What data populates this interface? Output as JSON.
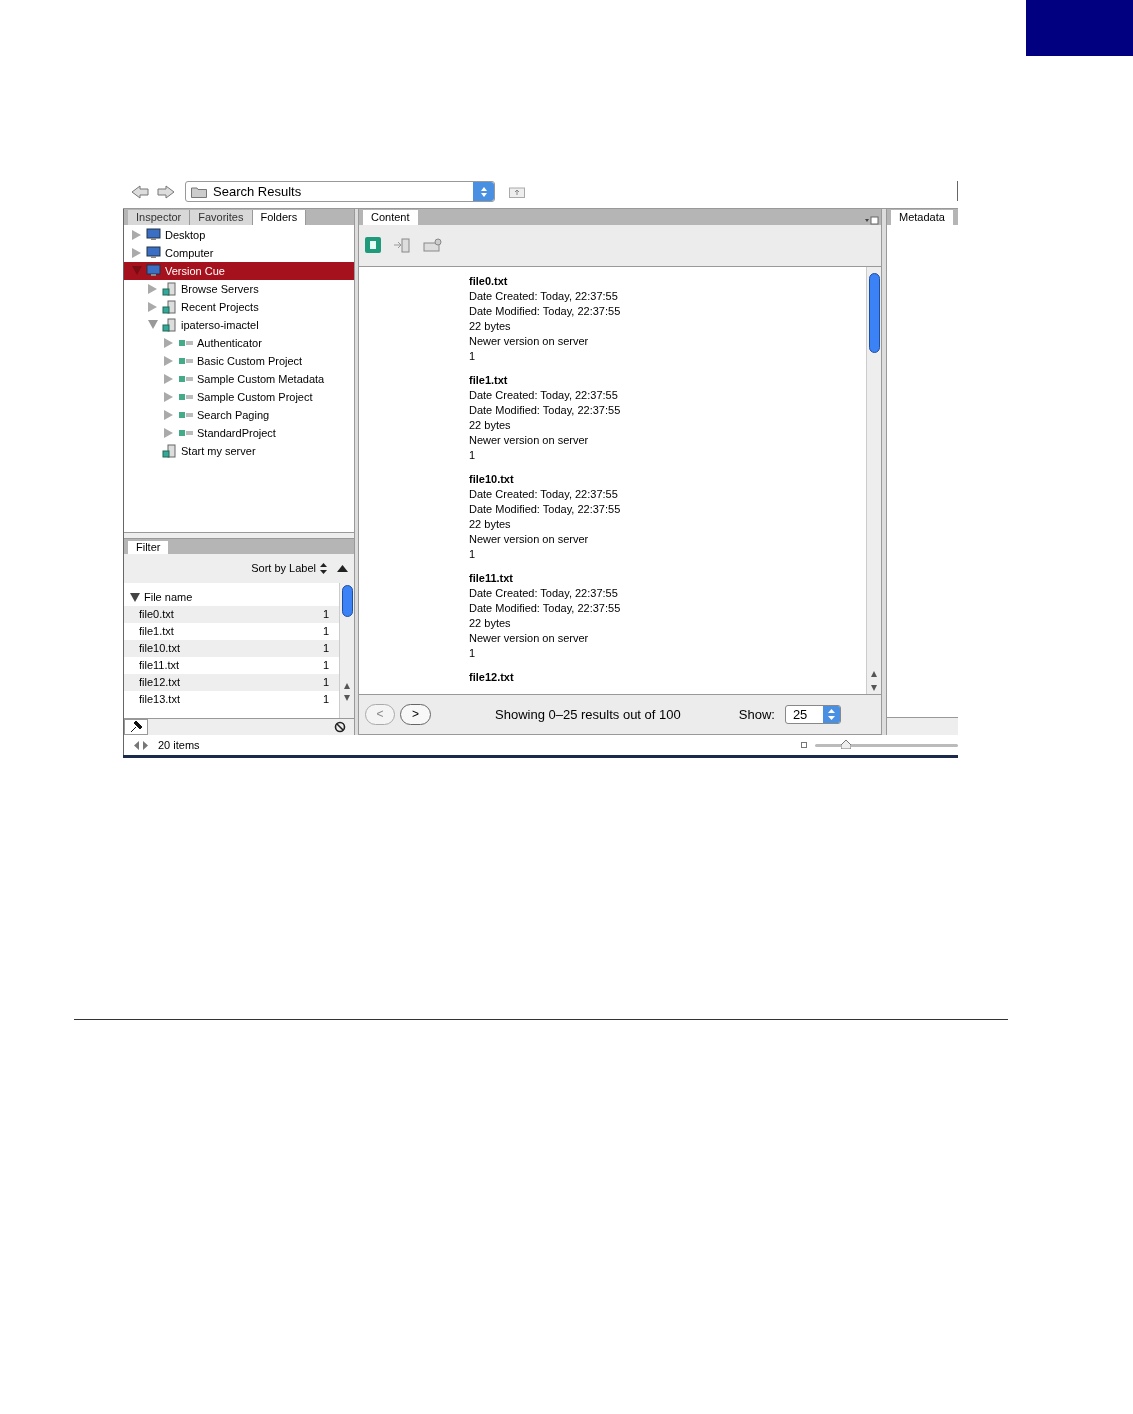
{
  "toolbar": {
    "path": "Search Results"
  },
  "left_panel": {
    "tabs": [
      {
        "label": "Inspector",
        "selected": false
      },
      {
        "label": "Favorites",
        "selected": false
      },
      {
        "label": "Folders",
        "selected": true
      }
    ],
    "tree": [
      {
        "label": "Desktop",
        "kind": "node",
        "expanded": false,
        "selected": false
      },
      {
        "label": "Computer",
        "kind": "node",
        "expanded": false,
        "selected": false
      },
      {
        "label": "Version Cue",
        "kind": "node",
        "expanded": true,
        "selected": true,
        "children": [
          {
            "label": "Browse Servers",
            "kind": "node",
            "expanded": false,
            "selected": false
          },
          {
            "label": "Recent Projects",
            "kind": "node",
            "expanded": false,
            "selected": false
          },
          {
            "label": "ipaterso-imactel",
            "kind": "node",
            "expanded": true,
            "selected": false,
            "children": [
              {
                "label": "Authenticator",
                "kind": "node",
                "expanded": false,
                "selected": false
              },
              {
                "label": "Basic Custom Project",
                "kind": "node",
                "expanded": false,
                "selected": false
              },
              {
                "label": "Sample Custom Metadata",
                "kind": "node",
                "expanded": false,
                "selected": false
              },
              {
                "label": "Sample Custom Project",
                "kind": "node",
                "expanded": false,
                "selected": false
              },
              {
                "label": "Search Paging",
                "kind": "node",
                "expanded": false,
                "selected": false
              },
              {
                "label": "StandardProject",
                "kind": "node",
                "expanded": false,
                "selected": false
              }
            ]
          },
          {
            "label": "Start my server",
            "kind": "leaf",
            "selected": false
          }
        ]
      }
    ],
    "filter_tab": "Filter",
    "sort": "Sort by Label",
    "filter_header": "File name",
    "filter_rows": [
      {
        "name": "file0.txt",
        "count": "1"
      },
      {
        "name": "file1.txt",
        "count": "1"
      },
      {
        "name": "file10.txt",
        "count": "1"
      },
      {
        "name": "file11.txt",
        "count": "1"
      },
      {
        "name": "file12.txt",
        "count": "1"
      },
      {
        "name": "file13.txt",
        "count": "1"
      }
    ]
  },
  "content": {
    "tab": "Content",
    "results": [
      {
        "name": "file0.txt",
        "lines": [
          "Date Created: Today, 22:37:55",
          "Date Modified: Today, 22:37:55",
          "22 bytes",
          "Newer version on server",
          "1"
        ]
      },
      {
        "name": "file1.txt",
        "lines": [
          "Date Created: Today, 22:37:55",
          "Date Modified: Today, 22:37:55",
          "22 bytes",
          "Newer version on server",
          "1"
        ]
      },
      {
        "name": "file10.txt",
        "lines": [
          "Date Created: Today, 22:37:55",
          "Date Modified: Today, 22:37:55",
          "22 bytes",
          "Newer version on server",
          "1"
        ]
      },
      {
        "name": "file11.txt",
        "lines": [
          "Date Created: Today, 22:37:55",
          "Date Modified: Today, 22:37:55",
          "22 bytes",
          "Newer version on server",
          "1"
        ]
      },
      {
        "name": "file12.txt"
      }
    ],
    "prev": "<",
    "next": ">",
    "pager": "Showing 0–25 results out of 100",
    "show_label": "Show:",
    "show_value": "25"
  },
  "metadata": {
    "tab": "Metadata"
  },
  "status": {
    "items": "20 items",
    "zoom_slider": {
      "level": 0.22
    }
  }
}
